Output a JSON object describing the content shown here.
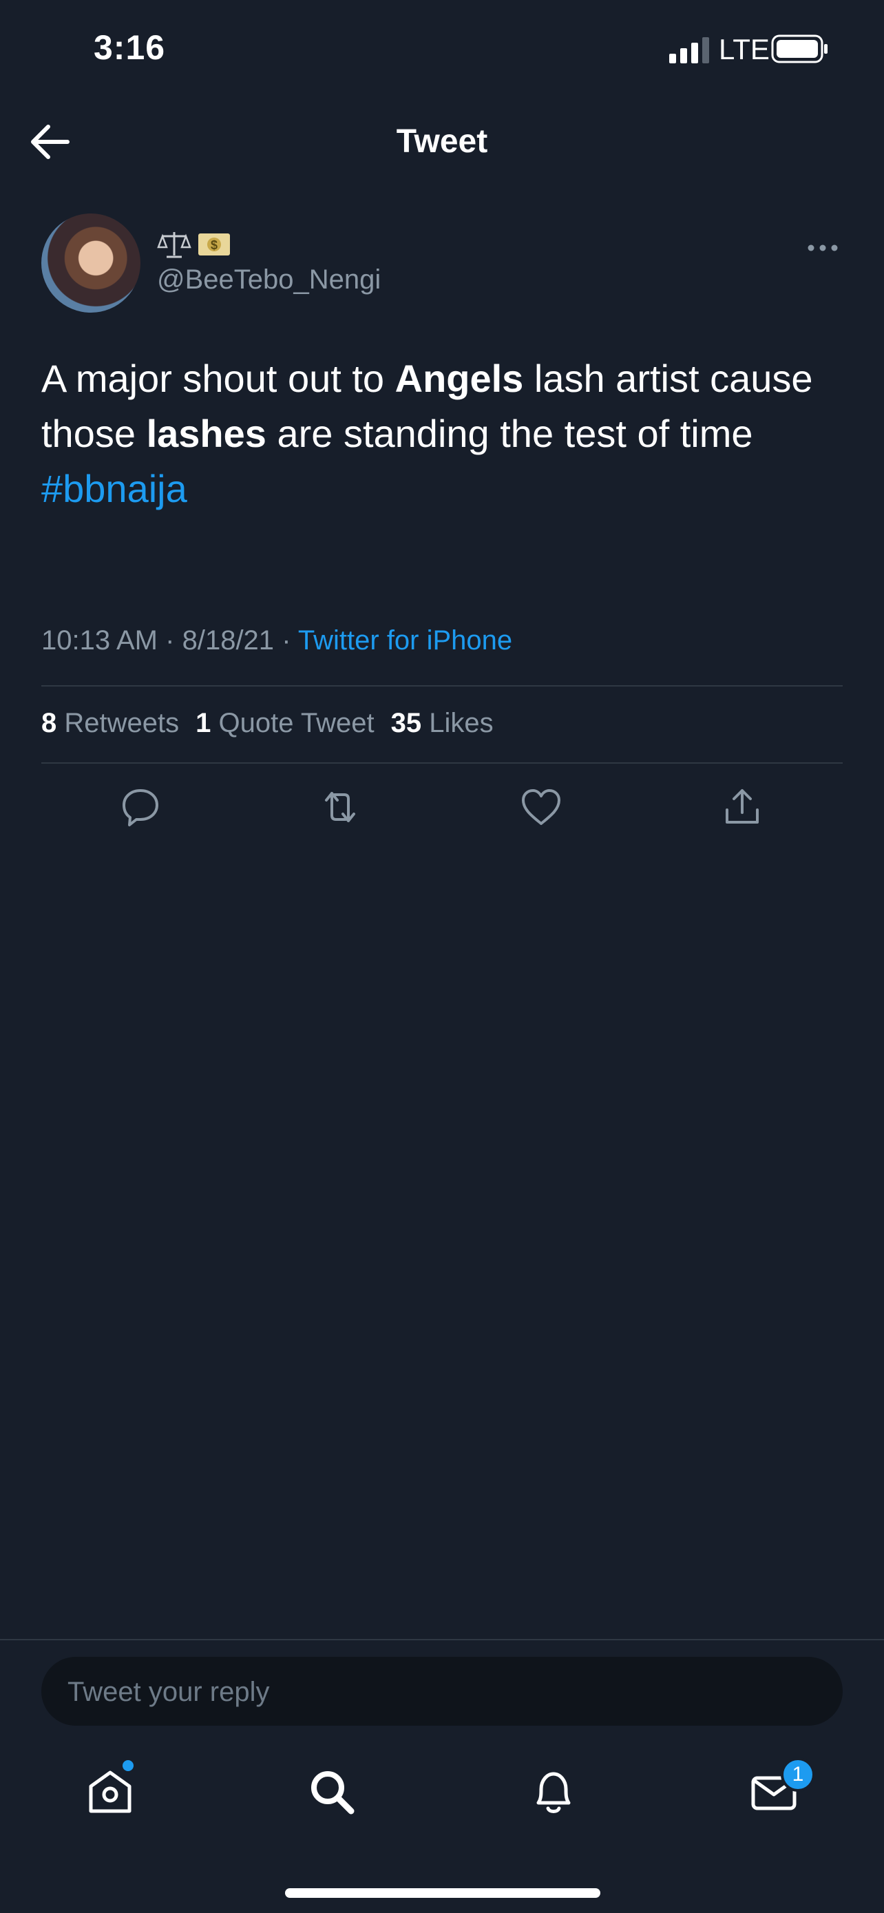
{
  "status_bar": {
    "time": "3:16",
    "network": "LTE"
  },
  "header": {
    "title": "Tweet"
  },
  "tweet": {
    "author_handle": "@BeeTebo_Nengi",
    "author_emojis": [
      "balance-scale-emoji",
      "money-bag-emoji"
    ],
    "text_parts": {
      "p1": "A major shout out to ",
      "b1": "Angels",
      "p2": " lash artist cause those ",
      "b2": "lashes",
      "p3": " are standing the test of time",
      "hashtag": "#bbnaija"
    },
    "time": "10:13 AM",
    "date": "8/18/21",
    "source": "Twitter for iPhone",
    "separator": "·",
    "stats": {
      "retweets_count": "8",
      "retweets_label": "Retweets",
      "quotes_count": "1",
      "quotes_label": "Quote Tweet",
      "likes_count": "35",
      "likes_label": "Likes"
    }
  },
  "reply": {
    "placeholder": "Tweet your reply"
  },
  "tab_bar": {
    "messages_badge": "1"
  },
  "colors": {
    "background": "#171e2a",
    "accent": "#1d9bf0",
    "secondary_text": "#8b98a5"
  }
}
